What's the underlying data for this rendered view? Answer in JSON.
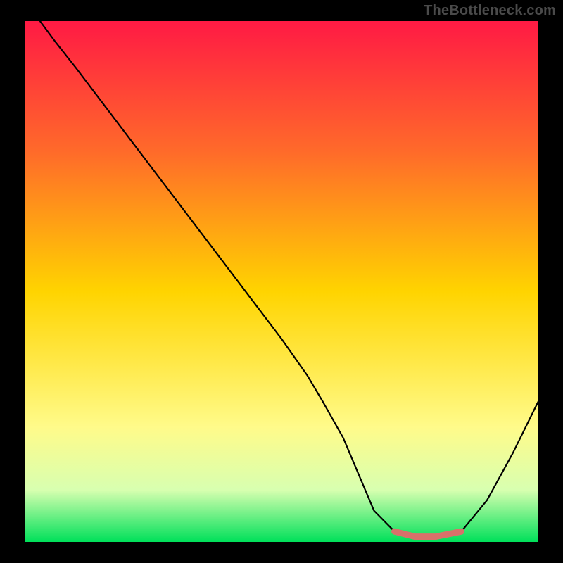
{
  "watermark": "TheBottleneck.com",
  "chart_data": {
    "type": "line",
    "title": "",
    "xlabel": "",
    "ylabel": "",
    "xlim": [
      0,
      100
    ],
    "ylim": [
      0,
      100
    ],
    "grid": false,
    "series": [
      {
        "name": "bottleneck-curve",
        "x": [
          3,
          6,
          10,
          15,
          20,
          25,
          30,
          35,
          40,
          45,
          50,
          55,
          58,
          62,
          65,
          68,
          72,
          76,
          80,
          85,
          90,
          95,
          100
        ],
        "y": [
          100,
          96,
          91,
          84.5,
          78,
          71.5,
          65,
          58.5,
          52,
          45.5,
          39,
          32,
          27,
          20,
          13,
          6,
          2,
          1,
          1,
          2,
          8,
          17,
          27
        ]
      }
    ],
    "trough_segment": {
      "name": "optimal-zone",
      "x": [
        72,
        76,
        80,
        85
      ],
      "y": [
        2,
        1,
        1,
        2
      ]
    },
    "background_gradient": {
      "top": "#ff1a44",
      "mid1": "#ff6a2a",
      "mid2": "#ffd400",
      "mid3": "#fffb8a",
      "mid4": "#d8ffb0",
      "bottom": "#00e05a"
    }
  }
}
